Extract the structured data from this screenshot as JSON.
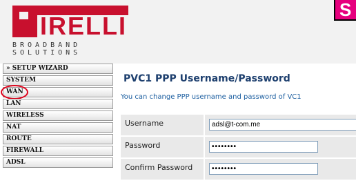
{
  "brand": {
    "logo_text": "IRELLI",
    "tagline_line1": "BROADBAND",
    "tagline_line2": "SOLUTIONS",
    "corner_badge": "S",
    "primary_color": "#c8102e"
  },
  "sidebar": {
    "items": [
      {
        "label": "» SETUP WIZARD"
      },
      {
        "label": "SYSTEM"
      },
      {
        "label": "WAN"
      },
      {
        "label": "LAN"
      },
      {
        "label": "WIRELESS"
      },
      {
        "label": "NAT"
      },
      {
        "label": "ROUTE"
      },
      {
        "label": "FIREWALL"
      },
      {
        "label": "ADSL"
      }
    ]
  },
  "main": {
    "title": "PVC1 PPP Username/Password",
    "description": "You can change PPP username and password of VC1",
    "form": {
      "username_label": "Username",
      "username_value": "adsl@t-com.me",
      "password_label": "Password",
      "password_value": "••••••••",
      "confirm_label": "Confirm Password",
      "confirm_value": "••••••••"
    }
  }
}
